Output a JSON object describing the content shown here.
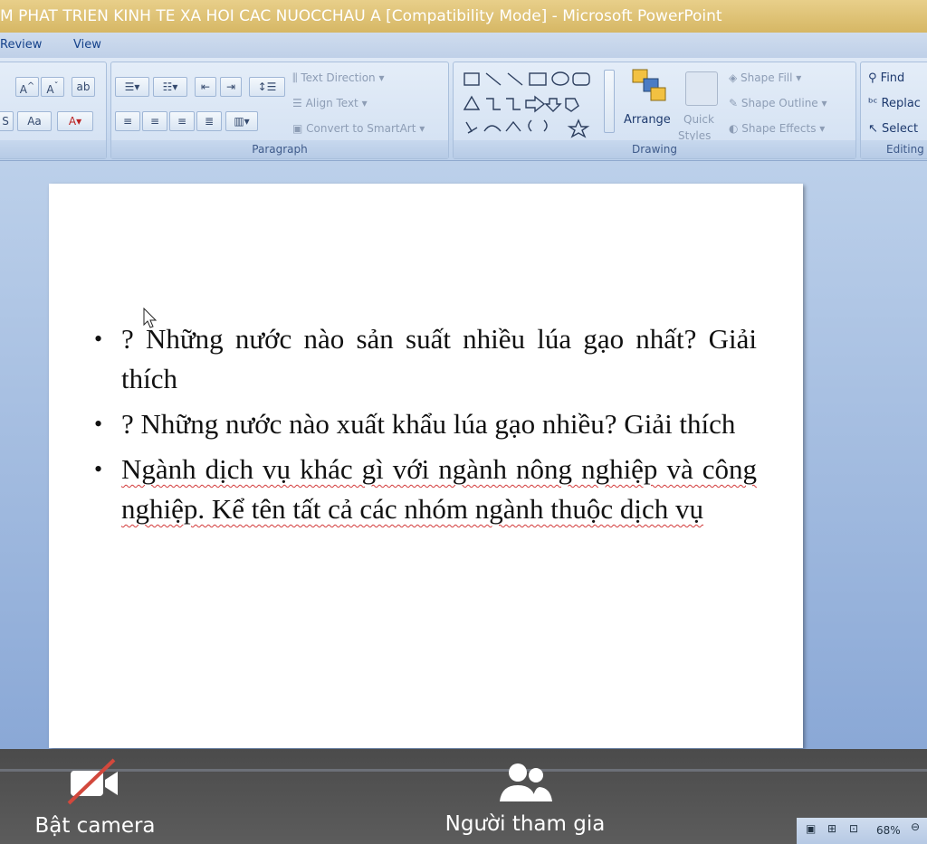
{
  "window": {
    "title": "M PHAT TRIEN KINH TE XA HOI CAC NUOCCHAU A [Compatibility Mode] - Microsoft PowerPoint"
  },
  "ribbon": {
    "tabs": [
      "Review",
      "View"
    ],
    "paragraph": {
      "text_direction": "Text Direction",
      "align_text": "Align Text",
      "convert_smartart": "Convert to SmartArt",
      "label": "Paragraph"
    },
    "drawing": {
      "arrange": "Arrange",
      "quick_styles_1": "Quick",
      "quick_styles_2": "Styles",
      "shape_fill": "Shape Fill",
      "shape_outline": "Shape Outline",
      "shape_effects": "Shape Effects",
      "label": "Drawing"
    },
    "editing": {
      "find": "Find",
      "replace": "Replac",
      "select": "Select",
      "label": "Editing"
    }
  },
  "slide": {
    "bullets": [
      "?  Những nước nào sản suất nhiều lúa gạo nhất? Giải thích",
      "? Những nước nào xuất khẩu lúa gạo nhiều? Giải thích",
      "Ngành dịch vụ khác gì với ngành nông nghiệp và công nghiệp. Kể tên tất cả các nhóm ngành thuộc dịch vụ"
    ]
  },
  "meeting": {
    "camera_label": "Bật camera",
    "participants_label": "Người tham gia"
  },
  "status": {
    "zoom": "68%"
  }
}
